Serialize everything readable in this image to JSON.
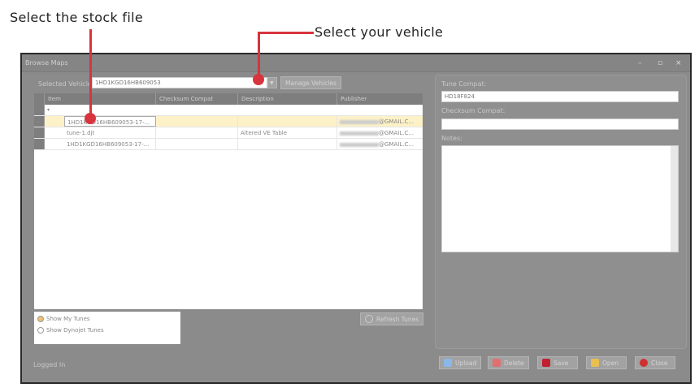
{
  "annotations": {
    "stock_file": "Select the stock file",
    "vehicle": "Select your vehicle"
  },
  "window": {
    "title": "Browse Maps",
    "controls": {
      "minimize": "–",
      "maximize": "▫",
      "close": "×"
    }
  },
  "vehicle": {
    "label": "Selected Vehicle:",
    "value": "1HD1KGD16HB609053",
    "manage_label": "Manage Vehicles"
  },
  "grid": {
    "columns": [
      "Item",
      "Checksum Compat",
      "Description",
      "Publisher"
    ],
    "group_label": "",
    "rows": [
      {
        "item": "1HD1KGD16HB609053-17-...",
        "checksum": "",
        "description": "",
        "publisher": "@GMAIL.C..."
      },
      {
        "item": "tune-1.djt",
        "checksum": "",
        "description": "Altered VE Table",
        "publisher": "@GMAIL.C..."
      },
      {
        "item": "1HD1KGD16HB609053-17-...",
        "checksum": "",
        "description": "",
        "publisher": "@GMAIL.C..."
      }
    ]
  },
  "filters": {
    "show_my": "Show My Tunes",
    "show_dynojet": "Show Dynojet Tunes",
    "selected": "show_my"
  },
  "refresh_label": "Refresh Tunes",
  "details": {
    "tune_compat_label": "Tune Compat:",
    "tune_compat_value": "HD18F824",
    "checksum_label": "Checksum Compat:",
    "checksum_value": "",
    "notes_label": "Notes:",
    "notes_value": ""
  },
  "status": "Logged In",
  "buttons": {
    "upload": "Upload",
    "delete": "Delete",
    "save": "Save",
    "open": "Open",
    "close": "Close"
  }
}
